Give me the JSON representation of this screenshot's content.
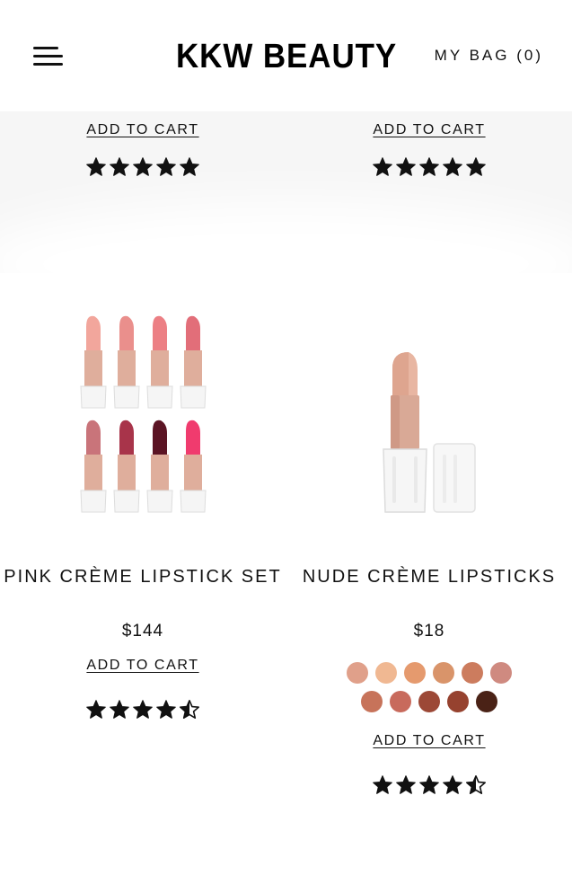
{
  "header": {
    "logo": "KKW BEAUTY",
    "bag_label": "MY BAG (0)"
  },
  "top_row": [
    {
      "add_to_cart": "ADD TO CART",
      "rating": 5
    },
    {
      "add_to_cart": "ADD TO CART",
      "rating": 5
    }
  ],
  "products": [
    {
      "name": "PINK CRÈME LIPSTICK SET",
      "price": "$144",
      "add_to_cart": "ADD TO CART",
      "rating": 4.5
    },
    {
      "name": "NUDE CRÈME LIPSTICKS",
      "price": "$18",
      "add_to_cart": "ADD TO CART",
      "rating": 4.5,
      "swatches_row1": [
        "#e0a08a",
        "#f0b892",
        "#e59a6e",
        "#d9946a",
        "#cc7c5e",
        "#cf8a80"
      ],
      "swatches_row2": [
        "#c7735a",
        "#c86a5c",
        "#9c4836",
        "#96422f",
        "#4a2216"
      ]
    }
  ],
  "colors": {
    "star": "#111111",
    "text": "#111111",
    "background": "#ffffff"
  }
}
